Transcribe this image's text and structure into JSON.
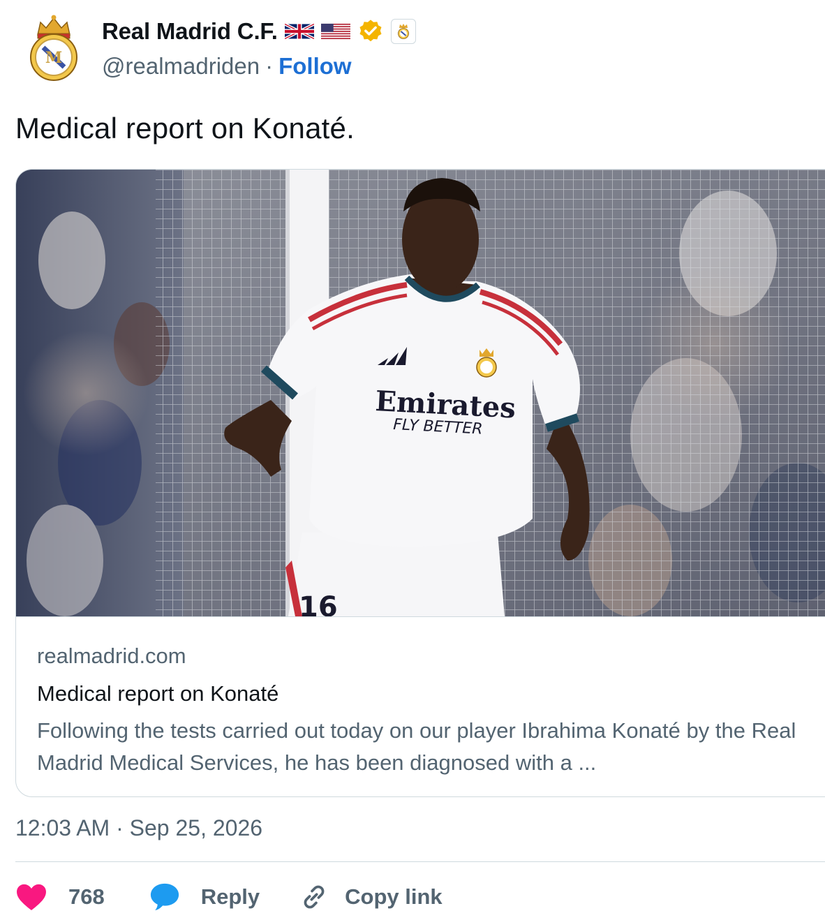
{
  "account": {
    "name": "Real Madrid C.F.",
    "handle": "@realmadriden",
    "separator": "·",
    "follow_label": "Follow",
    "badges": [
      "uk-flag-icon",
      "us-flag-icon",
      "verified-badge-icon",
      "club-crest-icon"
    ]
  },
  "tweet": {
    "text": "Medical report on Konaté."
  },
  "link_card": {
    "image_alt": "Real Madrid player in white kit with Emirates Fly Better sponsor, number 16, in front of goal net and crowd",
    "jersey_sponsor": "Emirates",
    "jersey_sponsor_tagline": "FLY BETTER",
    "shirt_number": "16",
    "domain": "realmadrid.com",
    "title": "Medical report on Konaté",
    "description": "Following the tests carried out today on our player Ibrahima Konaté by the Real Madrid Medical Services, he has been diagnosed with a ..."
  },
  "meta": {
    "timestamp": "12:03 AM · Sep 25, 2026"
  },
  "actions": {
    "like_count": "768",
    "reply_label": "Reply",
    "copy_label": "Copy link"
  },
  "colors": {
    "like": "#f91880",
    "reply": "#1d9bf0",
    "follow": "#1d6fd4",
    "secondary_text": "#536471",
    "verified": "#f4b400"
  }
}
